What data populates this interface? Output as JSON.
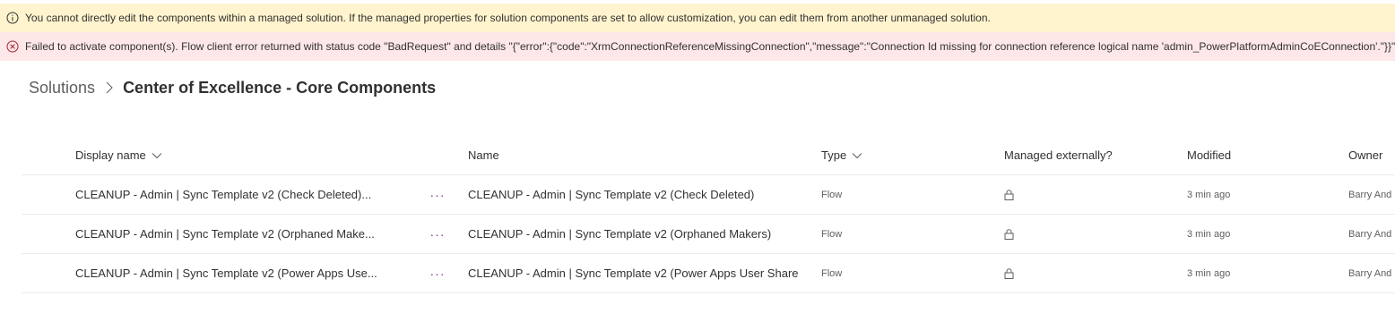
{
  "banners": {
    "info_text": "You cannot directly edit the components within a managed solution. If the managed properties for solution components are set to allow customization, you can edit them from another unmanaged solution.",
    "error_text": "Failed to activate component(s). Flow client error returned with status code \"BadRequest\" and details \"{\"error\":{\"code\":\"XrmConnectionReferenceMissingConnection\",\"message\":\"Connection Id missing for connection reference logical name 'admin_PowerPlatformAdminCoEConnection'.\"}}\"."
  },
  "breadcrumb": {
    "root": "Solutions",
    "current": "Center of Excellence - Core Components"
  },
  "table": {
    "headers": {
      "display_name": "Display name",
      "name": "Name",
      "type": "Type",
      "managed": "Managed externally?",
      "modified": "Modified",
      "owner": "Owner"
    },
    "rows": [
      {
        "display_name": "CLEANUP - Admin | Sync Template v2 (Check Deleted)...",
        "more": "···",
        "name": "CLEANUP - Admin | Sync Template v2 (Check Deleted)",
        "type": "Flow",
        "modified": "3 min ago",
        "owner": "Barry And"
      },
      {
        "display_name": "CLEANUP - Admin | Sync Template v2 (Orphaned Make...",
        "more": "···",
        "name": "CLEANUP - Admin | Sync Template v2 (Orphaned Makers)",
        "type": "Flow",
        "modified": "3 min ago",
        "owner": "Barry And"
      },
      {
        "display_name": "CLEANUP - Admin | Sync Template v2 (Power Apps Use...",
        "more": "···",
        "name": "CLEANUP - Admin | Sync Template v2 (Power Apps User Share",
        "type": "Flow",
        "modified": "3 min ago",
        "owner": "Barry And"
      }
    ]
  },
  "icons": {
    "info": "info-icon",
    "error": "error-circle-icon",
    "lock": "lock-icon",
    "chevron": "chevron-down-icon",
    "separator": "chevron-right-icon"
  },
  "colors": {
    "info_bg": "#fff4ce",
    "error_bg": "#fde7e9",
    "error_icon": "#a4262c",
    "more_accent": "#8a2aa3"
  }
}
